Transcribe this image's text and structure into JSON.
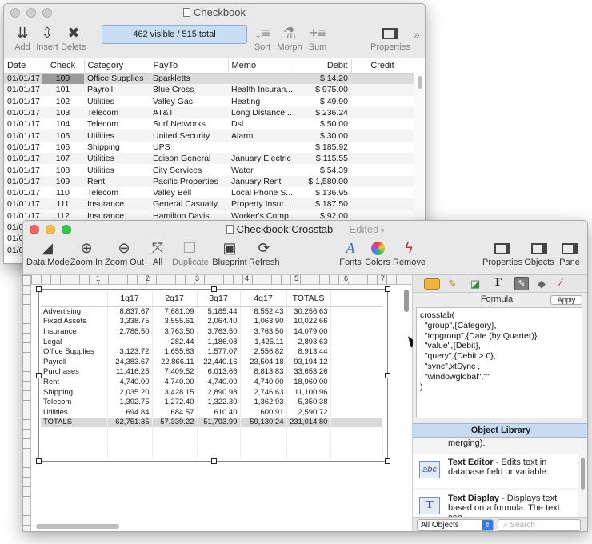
{
  "checkbook": {
    "title": "Checkbook",
    "toolbar": {
      "add": "Add",
      "insert": "Insert",
      "delete": "Delete",
      "status": "462 visible / 515 total",
      "sort": "Sort",
      "morph": "Morph",
      "sum": "Sum",
      "properties": "Properties"
    },
    "columns": [
      "Date",
      "Check",
      "Category",
      "PayTo",
      "Memo",
      "Debit",
      "Credit"
    ],
    "rows": [
      [
        "01/01/17",
        "100",
        "Office Supplies",
        "Sparkletts",
        "",
        "$ 14.20",
        ""
      ],
      [
        "01/01/17",
        "101",
        "Payroll",
        "Blue Cross",
        "Health Insuran...",
        "$ 975.00",
        ""
      ],
      [
        "01/01/17",
        "102",
        "Utilities",
        "Valley Gas",
        "Heating",
        "$ 49.90",
        ""
      ],
      [
        "01/01/17",
        "103",
        "Telecom",
        "AT&T",
        "Long Distance...",
        "$ 236.24",
        ""
      ],
      [
        "01/01/17",
        "104",
        "Telecom",
        "Surf Networks",
        "Dsl",
        "$ 50.00",
        ""
      ],
      [
        "01/01/17",
        "105",
        "Utilities",
        "United Security",
        "Alarm",
        "$ 30.00",
        ""
      ],
      [
        "01/01/17",
        "106",
        "Shipping",
        "UPS",
        "",
        "$ 185.92",
        ""
      ],
      [
        "01/01/17",
        "107",
        "Utilities",
        "Edison General",
        "January Electric",
        "$ 115.55",
        ""
      ],
      [
        "01/01/17",
        "108",
        "Utilities",
        "City Services",
        "Water",
        "$ 54.39",
        ""
      ],
      [
        "01/01/17",
        "109",
        "Rent",
        "Pacific Properties",
        "January Rent",
        "$ 1,580.00",
        ""
      ],
      [
        "01/01/17",
        "110",
        "Telecom",
        "Valley Bell",
        "Local Phone S...",
        "$ 136.95",
        ""
      ],
      [
        "01/01/17",
        "111",
        "Insurance",
        "General Casualty",
        "Property Insur...",
        "$ 187.50",
        ""
      ],
      [
        "01/01/17",
        "112",
        "Insurance",
        "Hamilton Davis",
        "Worker's Comp...",
        "$ 92.00",
        ""
      ],
      [
        "01/0",
        "",
        "",
        "",
        "",
        "",
        ""
      ],
      [
        "01/0",
        "",
        "",
        "",
        "",
        "",
        ""
      ],
      [
        "01/0",
        "",
        "",
        "",
        "",
        "",
        ""
      ]
    ]
  },
  "crosstab": {
    "title": "Checkbook:Crosstab",
    "edited": "— Edited",
    "toolbar": {
      "data_mode": "Data Mode",
      "zoom_in": "Zoom In",
      "zoom_out": "Zoom Out",
      "all": "All",
      "duplicate": "Duplicate",
      "blueprint": "Blueprint",
      "refresh": "Refresh",
      "fonts": "Fonts",
      "colors": "Colors",
      "remove": "Remove",
      "properties": "Properties",
      "objects": "Objects",
      "pane": "Pane"
    },
    "ruler": [
      "1",
      "2",
      "3",
      "4",
      "5",
      "6",
      "7"
    ],
    "table": {
      "headers": [
        "",
        "1q17",
        "2q17",
        "3q17",
        "4q17",
        "TOTALS"
      ],
      "rows": [
        [
          "Advertising",
          "8,837.67",
          "7,681.09",
          "5,185.44",
          "8,552.43",
          "30,256.63"
        ],
        [
          "Fixed Assets",
          "3,338.75",
          "3,555.61",
          "2,064.40",
          "1,063.90",
          "10,022.66"
        ],
        [
          "Insurance",
          "2,788.50",
          "3,763.50",
          "3,763.50",
          "3,763.50",
          "14,079.00"
        ],
        [
          "Legal",
          "",
          "282.44",
          "1,186.08",
          "1,425.11",
          "2,893.63"
        ],
        [
          "Office Supplies",
          "3,123.72",
          "1,655.83",
          "1,577.07",
          "2,556.82",
          "8,913.44"
        ],
        [
          "Payroll",
          "24,383.67",
          "22,866.11",
          "22,440.16",
          "23,504.18",
          "93,194.12"
        ],
        [
          "Purchases",
          "11,416.25",
          "7,409.52",
          "6,013.66",
          "8,813.83",
          "33,653.26"
        ],
        [
          "Rent",
          "4,740.00",
          "4,740.00",
          "4,740.00",
          "4,740.00",
          "18,960.00"
        ],
        [
          "Shipping",
          "2,035.20",
          "3,428.15",
          "2,890.98",
          "2,746.63",
          "11,100.96"
        ],
        [
          "Telecom",
          "1,392.75",
          "1,272.40",
          "1,322.30",
          "1,362.93",
          "5,350.38"
        ],
        [
          "Utilities",
          "694.84",
          "684.57",
          "610.40",
          "600.91",
          "2,590.72"
        ],
        [
          "TOTALS",
          "62,751.35",
          "57,339.22",
          "51,793.99",
          "59,130.24",
          "231,014.80"
        ]
      ]
    },
    "formula": {
      "label": "Formula",
      "apply": "Apply",
      "lines": [
        "crosstab(",
        "  \"group\",{Category},",
        "  \"topgroup\",{Date (by Quarter)},",
        "  \"value\",{Debit},",
        "  \"query\",{Debit > 0},",
        "  \"sync\",xtSync ,",
        "  \"windowglobal\",\"\"",
        ")"
      ]
    },
    "library": {
      "title": "Object Library",
      "partial": "merging).",
      "items": [
        {
          "name": "Text Editor",
          "sep": " - ",
          "desc": "Edits text in database field or variable.",
          "icon": "abc"
        },
        {
          "name": "Text Display",
          "sep": " - ",
          "desc": "Displays text based on a formula. The text can",
          "icon": "T"
        }
      ],
      "filter": "All Objects",
      "search_placeholder": "Search"
    }
  }
}
